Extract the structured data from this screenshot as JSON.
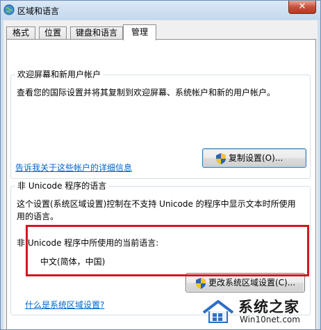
{
  "window": {
    "title": "区域和语言",
    "close_label": "✕"
  },
  "tabs": [
    {
      "label": "格式",
      "active": false
    },
    {
      "label": "位置",
      "active": false
    },
    {
      "label": "键盘和语言",
      "active": false
    },
    {
      "label": "管理",
      "active": true
    }
  ],
  "welcome_group": {
    "title": "欢迎屏幕和新用户帐户",
    "description": "查看您的国际设置并将其复制到欢迎屏幕、系统帐户和新的用户帐户。",
    "copy_button_label": "复制设置(O)...",
    "link_label": "告诉我关于这些帐户的详细信息"
  },
  "unicode_group": {
    "title": "非 Unicode 程序的语言",
    "description_line1": "这个设置(系统区域设置)控制在不支持 Unicode 的程序中显示文本时所使用",
    "description_line2": "用的语言。",
    "current_language_heading": "非 Unicode 程序中所使用的当前语言:",
    "current_language_value": "中文(简体，中国)",
    "change_button_label": "更改系统区域设置(C)...",
    "link_label": "什么是系统区域设置?"
  },
  "watermark": {
    "title": "系统之家",
    "url": "Win10net.com"
  },
  "colors": {
    "highlight_border": "#d0171f",
    "link": "#0066cc",
    "window_frame": "#cfdfee"
  }
}
